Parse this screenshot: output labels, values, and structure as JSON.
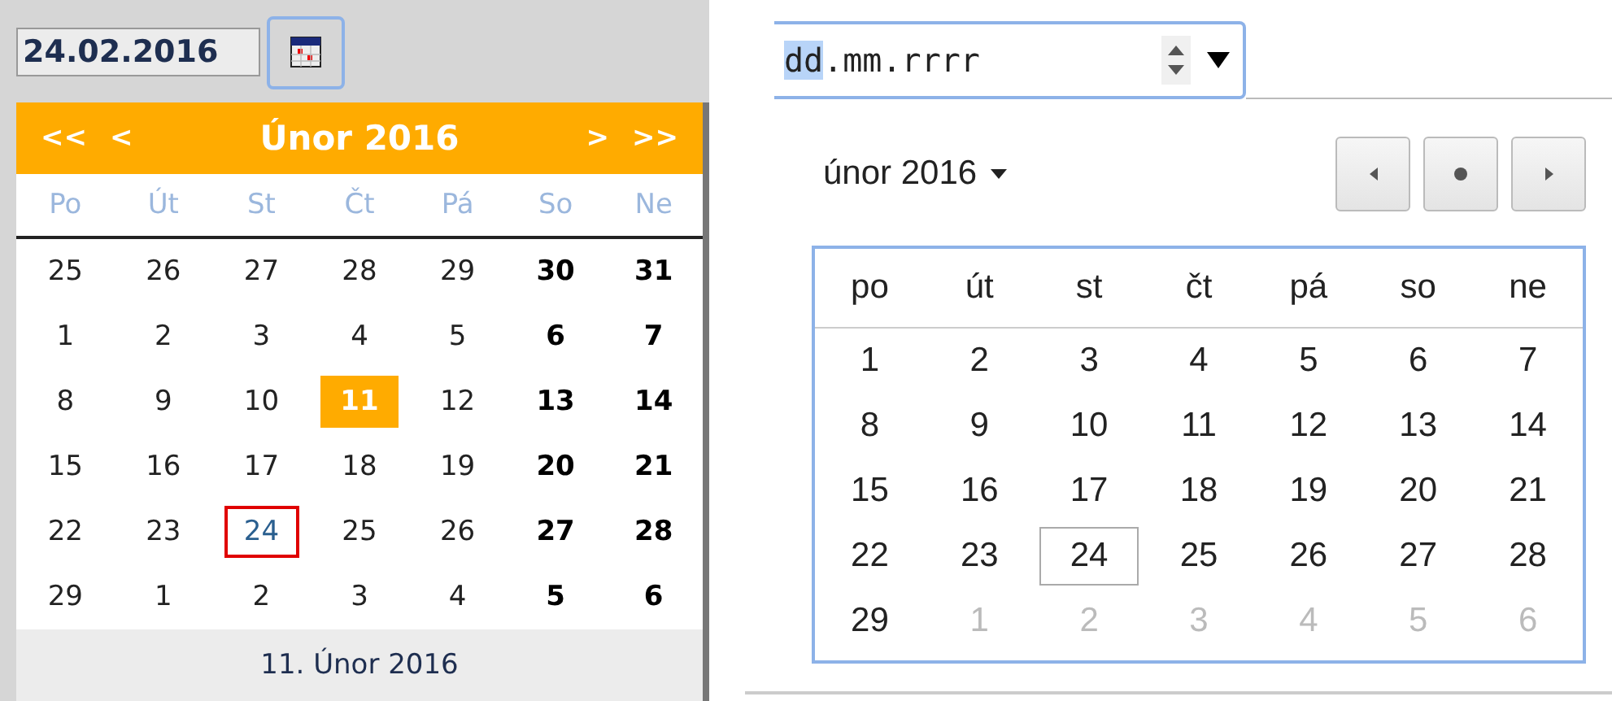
{
  "left": {
    "date_value": "24.02.2016",
    "nav": {
      "prev_year": "<<",
      "prev_month": "<",
      "title": "Únor 2016",
      "next_month": ">",
      "next_year": ">>"
    },
    "weekdays": [
      "Po",
      "Út",
      "St",
      "Čt",
      "Pá",
      "So",
      "Ne"
    ],
    "days": [
      {
        "d": "25",
        "bold": false,
        "today": false,
        "selected": false
      },
      {
        "d": "26",
        "bold": false,
        "today": false,
        "selected": false
      },
      {
        "d": "27",
        "bold": false,
        "today": false,
        "selected": false
      },
      {
        "d": "28",
        "bold": false,
        "today": false,
        "selected": false
      },
      {
        "d": "29",
        "bold": false,
        "today": false,
        "selected": false
      },
      {
        "d": "30",
        "bold": true,
        "today": false,
        "selected": false
      },
      {
        "d": "31",
        "bold": true,
        "today": false,
        "selected": false
      },
      {
        "d": "1",
        "bold": false,
        "today": false,
        "selected": false
      },
      {
        "d": "2",
        "bold": false,
        "today": false,
        "selected": false
      },
      {
        "d": "3",
        "bold": false,
        "today": false,
        "selected": false
      },
      {
        "d": "4",
        "bold": false,
        "today": false,
        "selected": false
      },
      {
        "d": "5",
        "bold": false,
        "today": false,
        "selected": false
      },
      {
        "d": "6",
        "bold": true,
        "today": false,
        "selected": false
      },
      {
        "d": "7",
        "bold": true,
        "today": false,
        "selected": false
      },
      {
        "d": "8",
        "bold": false,
        "today": false,
        "selected": false
      },
      {
        "d": "9",
        "bold": false,
        "today": false,
        "selected": false
      },
      {
        "d": "10",
        "bold": false,
        "today": false,
        "selected": false
      },
      {
        "d": "11",
        "bold": false,
        "today": true,
        "selected": false
      },
      {
        "d": "12",
        "bold": false,
        "today": false,
        "selected": false
      },
      {
        "d": "13",
        "bold": true,
        "today": false,
        "selected": false
      },
      {
        "d": "14",
        "bold": true,
        "today": false,
        "selected": false
      },
      {
        "d": "15",
        "bold": false,
        "today": false,
        "selected": false
      },
      {
        "d": "16",
        "bold": false,
        "today": false,
        "selected": false
      },
      {
        "d": "17",
        "bold": false,
        "today": false,
        "selected": false
      },
      {
        "d": "18",
        "bold": false,
        "today": false,
        "selected": false
      },
      {
        "d": "19",
        "bold": false,
        "today": false,
        "selected": false
      },
      {
        "d": "20",
        "bold": true,
        "today": false,
        "selected": false
      },
      {
        "d": "21",
        "bold": true,
        "today": false,
        "selected": false
      },
      {
        "d": "22",
        "bold": false,
        "today": false,
        "selected": false
      },
      {
        "d": "23",
        "bold": false,
        "today": false,
        "selected": false
      },
      {
        "d": "24",
        "bold": false,
        "today": false,
        "selected": true
      },
      {
        "d": "25",
        "bold": false,
        "today": false,
        "selected": false
      },
      {
        "d": "26",
        "bold": false,
        "today": false,
        "selected": false
      },
      {
        "d": "27",
        "bold": true,
        "today": false,
        "selected": false
      },
      {
        "d": "28",
        "bold": true,
        "today": false,
        "selected": false
      },
      {
        "d": "29",
        "bold": false,
        "today": false,
        "selected": false
      },
      {
        "d": "1",
        "bold": false,
        "today": false,
        "selected": false
      },
      {
        "d": "2",
        "bold": false,
        "today": false,
        "selected": false
      },
      {
        "d": "3",
        "bold": false,
        "today": false,
        "selected": false
      },
      {
        "d": "4",
        "bold": false,
        "today": false,
        "selected": false
      },
      {
        "d": "5",
        "bold": true,
        "today": false,
        "selected": false
      },
      {
        "d": "6",
        "bold": true,
        "today": false,
        "selected": false
      }
    ],
    "footer": "11. Únor 2016"
  },
  "right": {
    "field": {
      "day": "dd",
      "sep1": ".",
      "month": "mm",
      "sep2": ".",
      "year": "rrrr"
    },
    "month_label": "únor 2016",
    "weekdays": [
      "po",
      "út",
      "st",
      "čt",
      "pá",
      "so",
      "ne"
    ],
    "days": [
      {
        "d": "1",
        "outside": false,
        "selected": false
      },
      {
        "d": "2",
        "outside": false,
        "selected": false
      },
      {
        "d": "3",
        "outside": false,
        "selected": false
      },
      {
        "d": "4",
        "outside": false,
        "selected": false
      },
      {
        "d": "5",
        "outside": false,
        "selected": false
      },
      {
        "d": "6",
        "outside": false,
        "selected": false
      },
      {
        "d": "7",
        "outside": false,
        "selected": false
      },
      {
        "d": "8",
        "outside": false,
        "selected": false
      },
      {
        "d": "9",
        "outside": false,
        "selected": false
      },
      {
        "d": "10",
        "outside": false,
        "selected": false
      },
      {
        "d": "11",
        "outside": false,
        "selected": false
      },
      {
        "d": "12",
        "outside": false,
        "selected": false
      },
      {
        "d": "13",
        "outside": false,
        "selected": false
      },
      {
        "d": "14",
        "outside": false,
        "selected": false
      },
      {
        "d": "15",
        "outside": false,
        "selected": false
      },
      {
        "d": "16",
        "outside": false,
        "selected": false
      },
      {
        "d": "17",
        "outside": false,
        "selected": false
      },
      {
        "d": "18",
        "outside": false,
        "selected": false
      },
      {
        "d": "19",
        "outside": false,
        "selected": false
      },
      {
        "d": "20",
        "outside": false,
        "selected": false
      },
      {
        "d": "21",
        "outside": false,
        "selected": false
      },
      {
        "d": "22",
        "outside": false,
        "selected": false
      },
      {
        "d": "23",
        "outside": false,
        "selected": false
      },
      {
        "d": "24",
        "outside": false,
        "selected": true
      },
      {
        "d": "25",
        "outside": false,
        "selected": false
      },
      {
        "d": "26",
        "outside": false,
        "selected": false
      },
      {
        "d": "27",
        "outside": false,
        "selected": false
      },
      {
        "d": "28",
        "outside": false,
        "selected": false
      },
      {
        "d": "29",
        "outside": false,
        "selected": false
      },
      {
        "d": "1",
        "outside": true,
        "selected": false
      },
      {
        "d": "2",
        "outside": true,
        "selected": false
      },
      {
        "d": "3",
        "outside": true,
        "selected": false
      },
      {
        "d": "4",
        "outside": true,
        "selected": false
      },
      {
        "d": "5",
        "outside": true,
        "selected": false
      },
      {
        "d": "6",
        "outside": true,
        "selected": false
      }
    ]
  }
}
